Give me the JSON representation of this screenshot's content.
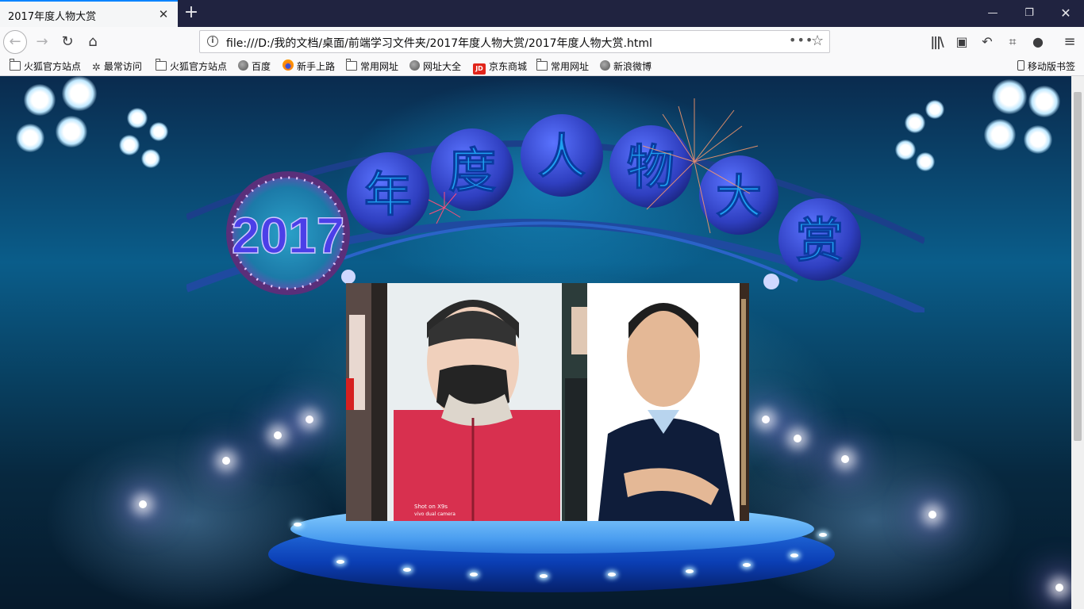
{
  "browser": {
    "tab_title": "2017年度人物大赏",
    "url": "file:///D:/我的文档/桌面/前端学习文件夹/2017年度人物大赏/2017年度人物大赏.html",
    "badge": "!"
  },
  "bookmarks": [
    {
      "label": "火狐官方站点",
      "icon": "folder-icon"
    },
    {
      "label": "最常访问",
      "icon": "gear-icon"
    },
    {
      "label": "火狐官方站点",
      "icon": "folder-icon"
    },
    {
      "label": "百度",
      "icon": "globe-icon"
    },
    {
      "label": "新手上路",
      "icon": "firefox-icon"
    },
    {
      "label": "常用网址",
      "icon": "folder-icon"
    },
    {
      "label": "网址大全",
      "icon": "globe-icon"
    },
    {
      "label": "京东商城",
      "icon": "jd-icon"
    },
    {
      "label": "常用网址",
      "icon": "folder-icon"
    },
    {
      "label": "新浪微博",
      "icon": "globe-icon"
    }
  ],
  "bookmarks_right": "移动版书签",
  "jd_logo": "JD",
  "banner": {
    "year": "2017",
    "characters": [
      "年",
      "度",
      "人",
      "物",
      "大",
      "赏"
    ]
  },
  "gallery": {
    "photo_watermark": [
      "Shot on X9s",
      "vivo dual camera"
    ]
  },
  "colors": {
    "accent": "#0a84ff",
    "banner_disc": "#3a56d6",
    "banner_text": "#1ea0f0",
    "year_text": "#4b3fe8",
    "podium": "#4b9ef0"
  }
}
